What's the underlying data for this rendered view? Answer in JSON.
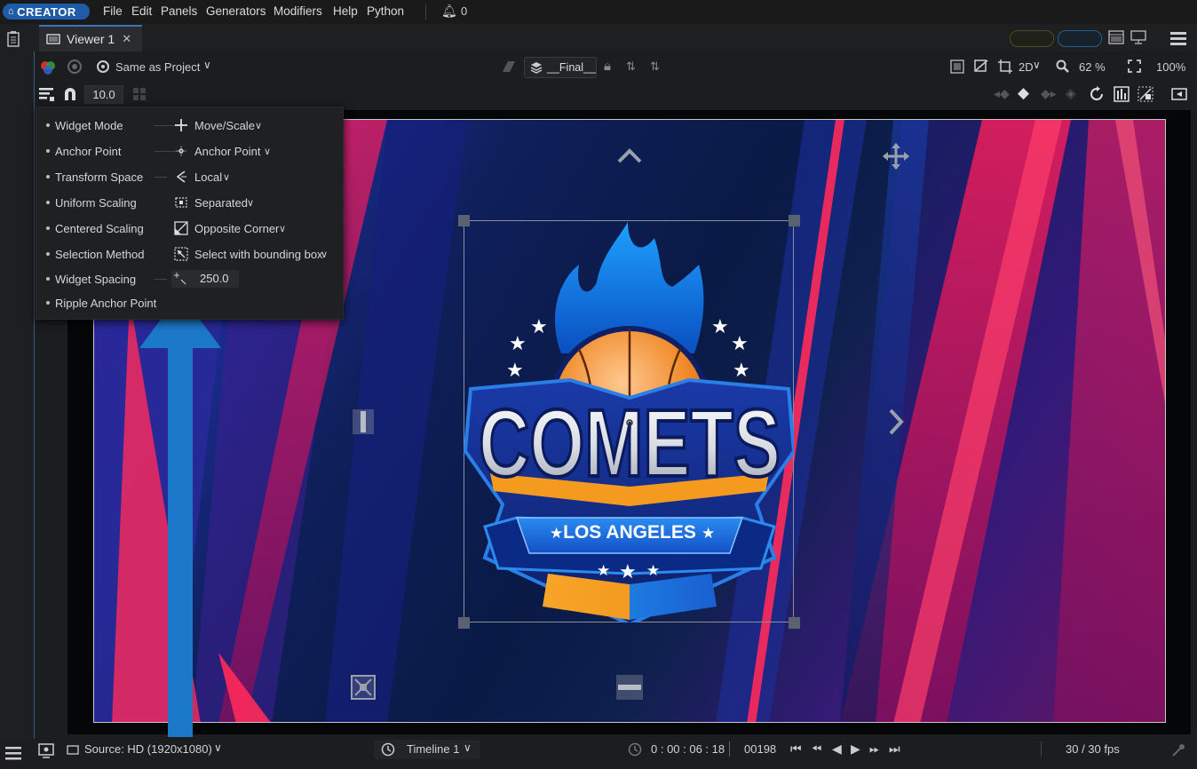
{
  "menubar": {
    "logo": "CREATOR",
    "items": [
      "File",
      "Edit",
      "Panels",
      "Generators",
      "Modifiers",
      "Help",
      "Python"
    ],
    "notifications": "0"
  },
  "tab": {
    "label": "Viewer 1"
  },
  "toolbar": {
    "color_space": "Same as Project",
    "render_layer": "__Final__",
    "view_mode": "2D",
    "zoom": "62 %",
    "resolution": "100%",
    "snap_value": "10.0"
  },
  "popup": {
    "rows": [
      {
        "label": "Widget Mode",
        "value": "Move/Scale"
      },
      {
        "label": "Anchor Point",
        "value": "Anchor Point"
      },
      {
        "label": "Transform Space",
        "value": "Local"
      },
      {
        "label": "Uniform Scaling",
        "value": "Separated"
      },
      {
        "label": "Centered Scaling",
        "value": "Opposite Corner"
      },
      {
        "label": "Selection Method",
        "value": "Select with bounding box"
      },
      {
        "label": "Widget Spacing",
        "value": "250.0"
      },
      {
        "label": "Ripple Anchor Point",
        "value": ""
      }
    ]
  },
  "artwork": {
    "title": "COMETS",
    "subtitle": "LOS ANGELES",
    "banner_stars": "★",
    "colors": {
      "accent_blue": "#1e7be0",
      "orange": "#f39a1f",
      "pink": "#e0164f"
    }
  },
  "statusbar": {
    "source": "Source: HD (1920x1080)",
    "timeline": "Timeline 1",
    "timecode": "0 : 00 : 06 : 18",
    "frame": "00198",
    "fps": "30 / 30 fps"
  }
}
